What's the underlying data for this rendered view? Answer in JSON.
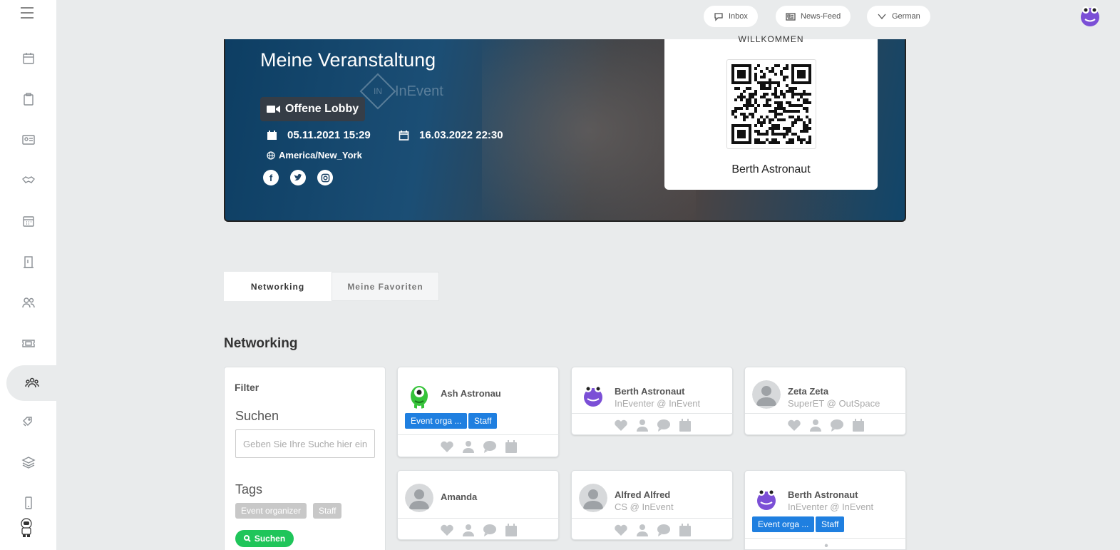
{
  "sidebar": {
    "items": [
      {
        "icon": "calendar-icon"
      },
      {
        "icon": "clipboard-icon"
      },
      {
        "icon": "id-card-icon"
      },
      {
        "icon": "handshake-icon"
      },
      {
        "icon": "calendar-grid-icon"
      },
      {
        "icon": "building-icon"
      },
      {
        "icon": "users-icon"
      },
      {
        "icon": "ticket-icon"
      },
      {
        "icon": "group-icon"
      },
      {
        "icon": "tags-icon"
      },
      {
        "icon": "layers-icon"
      },
      {
        "icon": "mobile-icon"
      }
    ],
    "active_index": 8
  },
  "topbar": {
    "inbox_label": "Inbox",
    "newsfeed_label": "News-Feed",
    "language_label": "German"
  },
  "banner": {
    "title": "Meine Veranstaltung",
    "lobby_label": "Offene Lobby",
    "start_date": "05.11.2021 15:29",
    "end_date": "16.03.2022 22:30",
    "timezone": "America/New_York",
    "logo_text": "InEvent",
    "logo_mark": "IN"
  },
  "qr_card": {
    "welcome": "WILLKOMMEN",
    "name": "Berth Astronaut"
  },
  "tabs": [
    {
      "label": "Networking",
      "active": true
    },
    {
      "label": "Meine Favoriten",
      "active": false
    }
  ],
  "section_title": "Networking",
  "filter": {
    "heading": "Filter",
    "search_label": "Suchen",
    "search_placeholder": "Geben Sie Ihre Suche hier ein",
    "tags_label": "Tags",
    "tags": [
      "Event organizer",
      "Staff"
    ],
    "search_button": "Suchen"
  },
  "people": [
    {
      "name": "Ash Astronau",
      "subtitle": "",
      "avatar": "green-alien",
      "badges": [
        "Event orga ...",
        "Staff"
      ]
    },
    {
      "name": "Berth Astronaut",
      "subtitle": "InEventer @ InEvent",
      "avatar": "purple-monster",
      "badges": []
    },
    {
      "name": "Zeta Zeta",
      "subtitle": "SuperET @ OutSpace",
      "avatar": "default",
      "badges": []
    },
    {
      "name": "Amanda",
      "subtitle": "",
      "avatar": "default",
      "badges": []
    },
    {
      "name": "Alfred Alfred",
      "subtitle": "CS @ InEvent",
      "avatar": "default",
      "badges": []
    },
    {
      "name": "Berth Astronaut",
      "subtitle": "InEventer @ InEvent",
      "avatar": "purple-monster",
      "badges": [
        "Event orga ...",
        "Staff"
      ]
    }
  ]
}
